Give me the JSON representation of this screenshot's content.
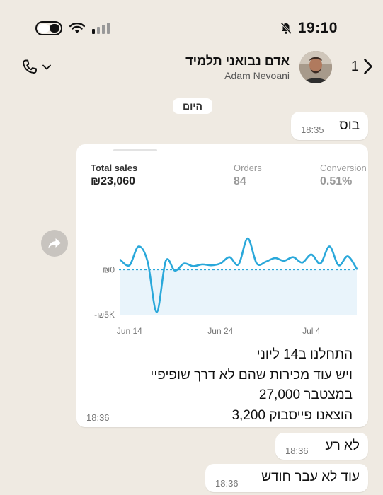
{
  "status_bar": {
    "time": "19:10",
    "icons": [
      "toggle-icon",
      "wifi-icon",
      "cellular-icon",
      "bell-slash-icon"
    ]
  },
  "header": {
    "contact_name": "אדם נבואני תלמיד",
    "contact_subtitle": "Adam Nevoani",
    "back_count": "1",
    "icons": [
      "phone-icon",
      "chevron-down-icon",
      "chevron-right-icon",
      "avatar"
    ]
  },
  "date_chip": "היום",
  "messages": [
    {
      "text": "בוס",
      "time": "18:35",
      "direction": "incoming"
    },
    {
      "type": "image",
      "image": {
        "metrics": [
          {
            "label": "Total sales",
            "value": "₪23,060"
          },
          {
            "label": "Orders",
            "value": "84"
          },
          {
            "label": "Conversion",
            "value": "0.51%"
          }
        ]
      },
      "caption_lines": [
        "התחלנו ב14 ליוני",
        "ויש עוד מכירות שהם לא דרך שופיפיי",
        "במצטבר 27,000",
        "הוצאנו פייסבוק 3,200"
      ],
      "time": "18:36"
    },
    {
      "text": "לא רע",
      "time": "18:36"
    },
    {
      "text": "עוד לא עבר חודש",
      "time": "18:36"
    }
  ],
  "chart_data": {
    "type": "line",
    "x": [
      "Jun 13",
      "Jun 14",
      "Jun 15",
      "Jun 16",
      "Jun 17",
      "Jun 18",
      "Jun 19",
      "Jun 20",
      "Jun 21",
      "Jun 22",
      "Jun 23",
      "Jun 24",
      "Jun 25",
      "Jun 26",
      "Jun 27",
      "Jun 28",
      "Jun 29",
      "Jun 30",
      "Jul 1",
      "Jul 2",
      "Jul 3",
      "Jul 4",
      "Jul 5",
      "Jul 6",
      "Jul 7",
      "Jul 8",
      "Jul 9"
    ],
    "values": [
      1100,
      500,
      2600,
      900,
      -4700,
      1000,
      -100,
      700,
      400,
      600,
      500,
      700,
      1400,
      600,
      3500,
      700,
      900,
      1300,
      1000,
      1400,
      800,
      1700,
      700,
      2600,
      500,
      1500,
      100
    ],
    "ylim": [
      -5000,
      5000
    ],
    "y_ticks": [
      "₪0",
      "-₪5K"
    ],
    "x_ticks": [
      "Jun 14",
      "Jun 24",
      "Jul 4"
    ],
    "baseline": 0,
    "colors": {
      "line": "#2aa8da",
      "baseline": "#2aa8da",
      "fill": "#e9f4fb"
    }
  }
}
